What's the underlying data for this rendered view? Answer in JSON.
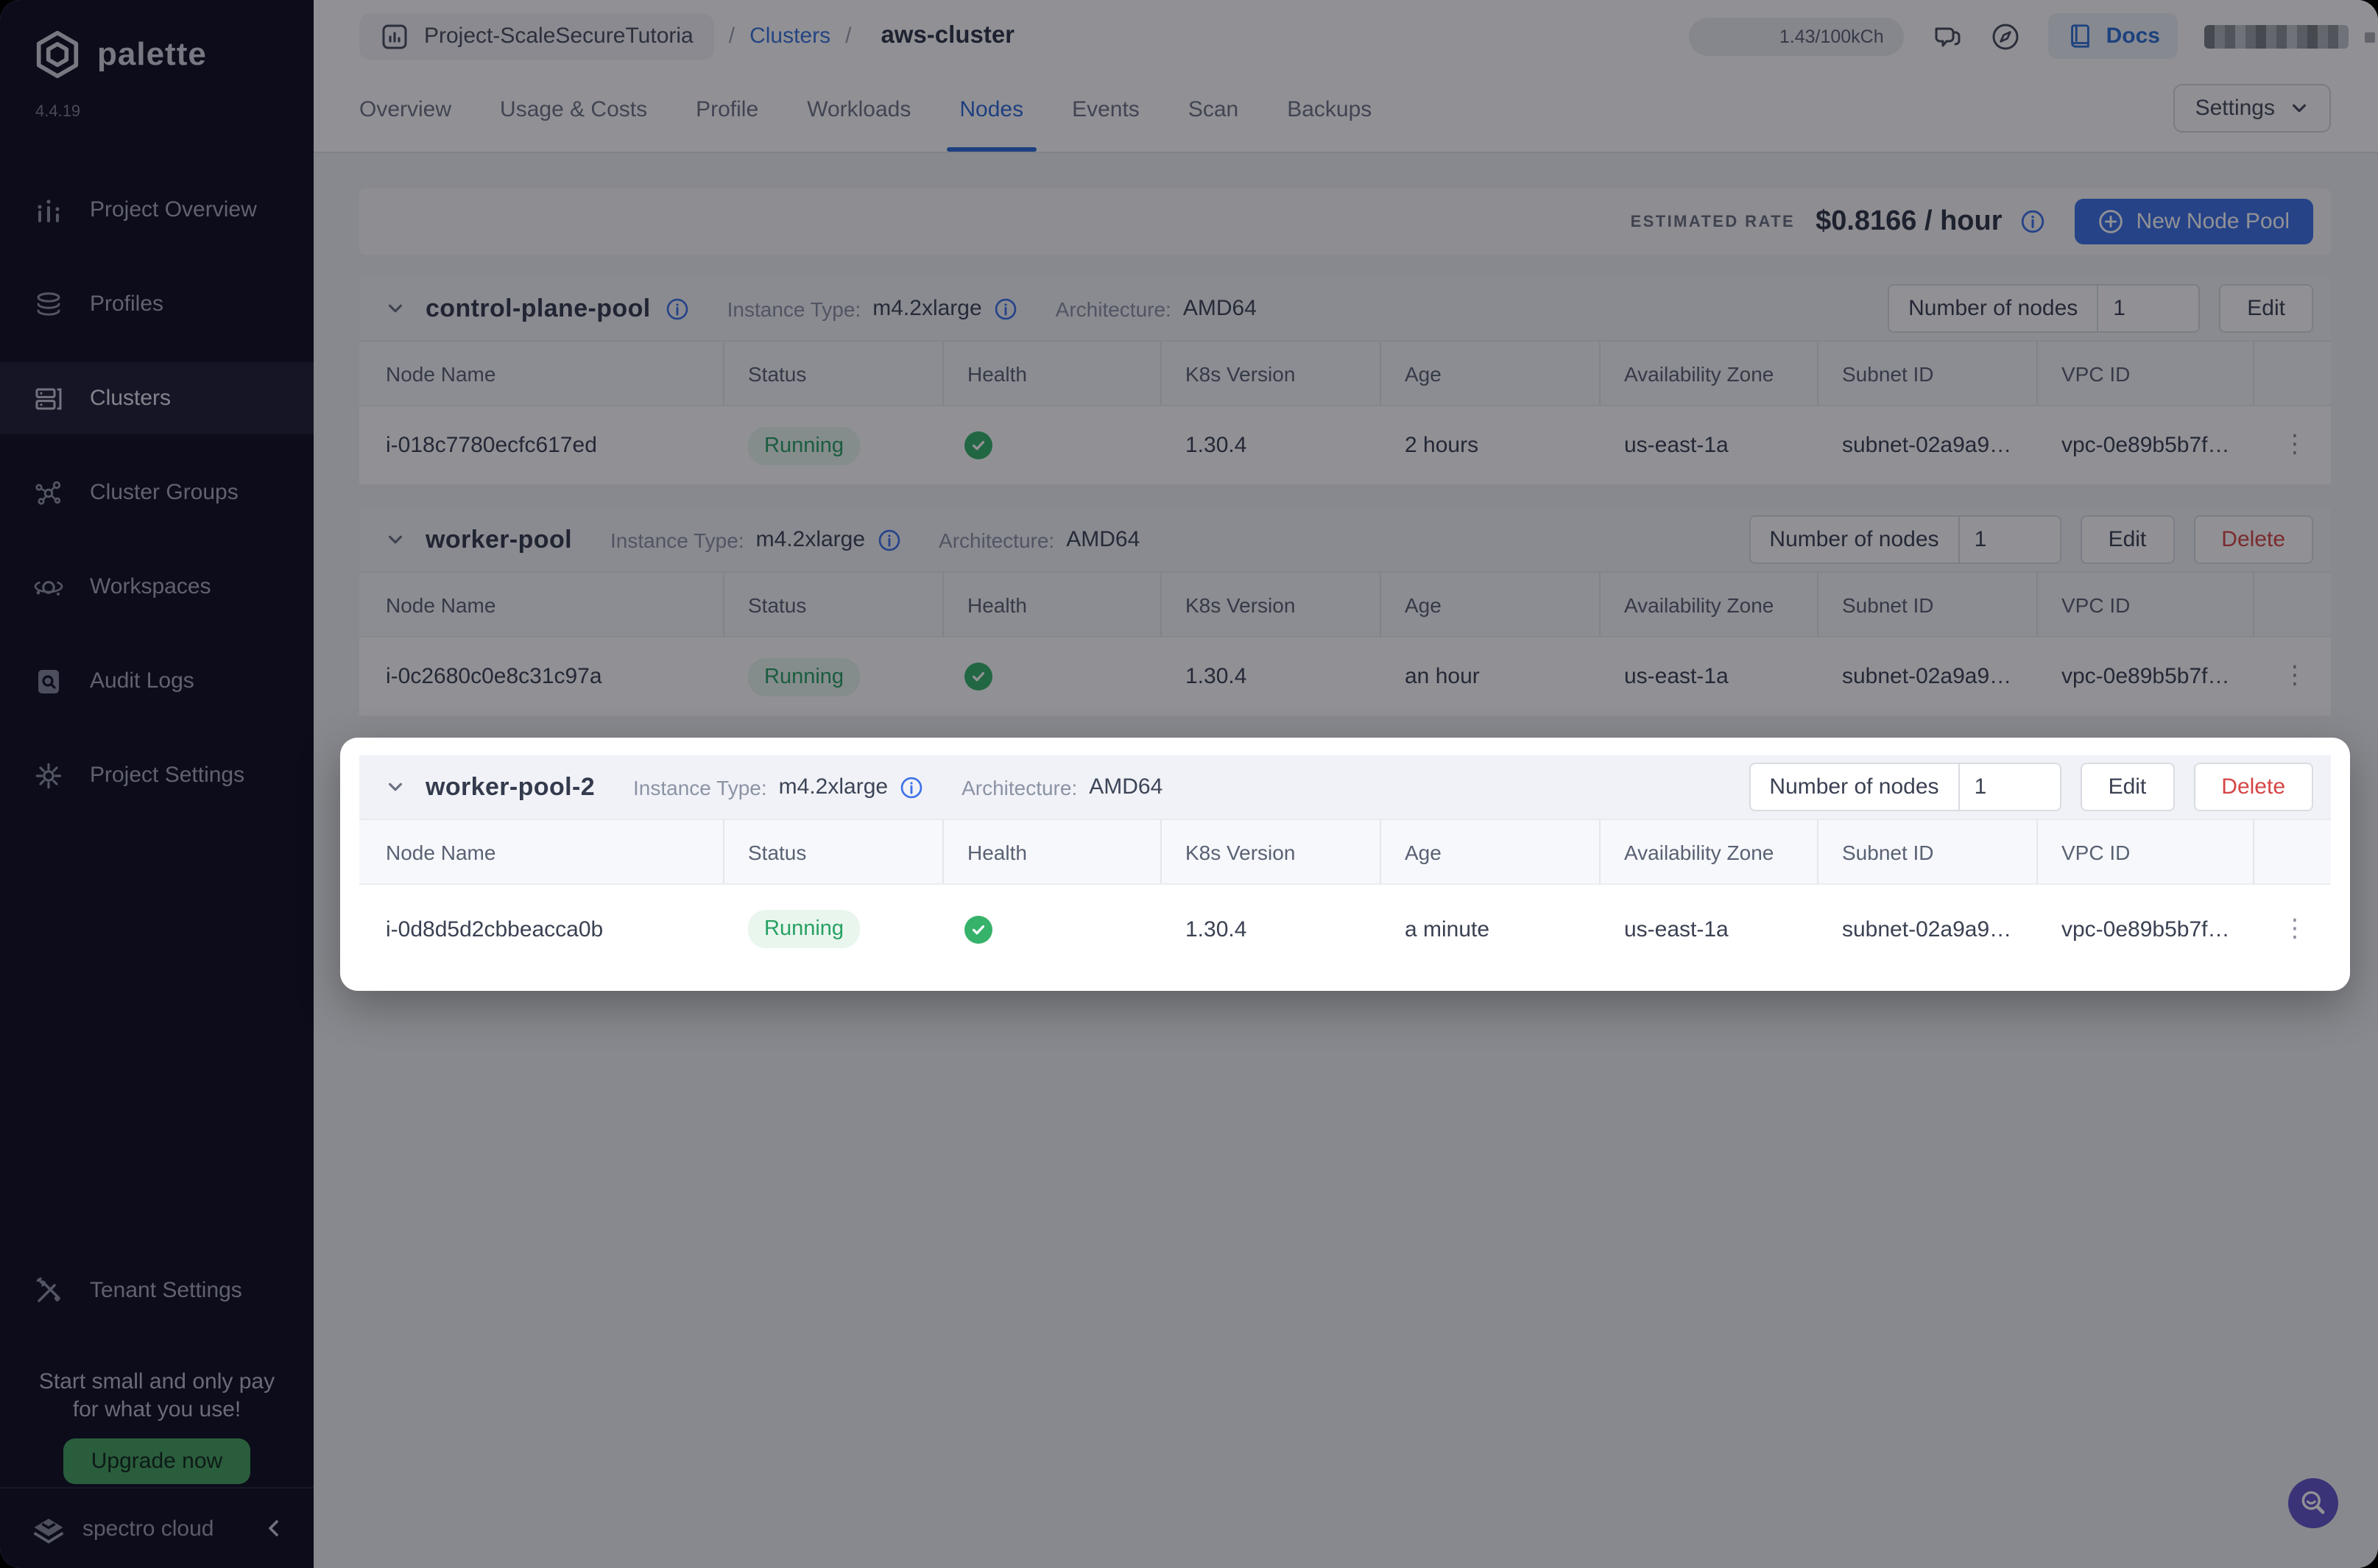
{
  "brand": {
    "name": "palette",
    "version": "4.4.19",
    "footer": "spectro cloud"
  },
  "colors": {
    "accent_blue": "#3d72e8",
    "link_blue": "#3b74dd",
    "active_tab_blue": "#2f6bd9",
    "success_green": "#36b26a",
    "badge_green_bg": "#e9f6ee",
    "badge_green_text": "#27a163",
    "danger_red": "#d64545",
    "sidebar_bg": "#0e0d1f",
    "fab_purple": "#6155c8",
    "upgrade_green": "#44a15e"
  },
  "sidebar": {
    "items": [
      {
        "label": "Project Overview",
        "icon": "bar-chart-icon",
        "active": false
      },
      {
        "label": "Profiles",
        "icon": "layers-icon",
        "active": false
      },
      {
        "label": "Clusters",
        "icon": "server-icon",
        "active": true
      },
      {
        "label": "Cluster Groups",
        "icon": "network-icon",
        "active": false
      },
      {
        "label": "Workspaces",
        "icon": "orbit-icon",
        "active": false
      },
      {
        "label": "Audit Logs",
        "icon": "audit-log-icon",
        "active": false
      },
      {
        "label": "Project Settings",
        "icon": "gear-icon",
        "active": false
      }
    ],
    "tenant_settings": "Tenant Settings",
    "promo": {
      "line1": "Start small and only pay",
      "line2": "for what you use!",
      "button": "Upgrade now"
    }
  },
  "topbar": {
    "project": "Project-ScaleSecureTutoria",
    "separator": "/",
    "clusters_link": "Clusters",
    "cluster_name": "aws-cluster",
    "usage": "1.43/100kCh",
    "docs": "Docs"
  },
  "tabs": {
    "items": [
      "Overview",
      "Usage & Costs",
      "Profile",
      "Workloads",
      "Nodes",
      "Events",
      "Scan",
      "Backups"
    ],
    "active": "Nodes",
    "settings": "Settings"
  },
  "ratebar": {
    "label": "ESTIMATED RATE",
    "value": "$0.8166 / hour",
    "new_pool": "New Node Pool"
  },
  "labels": {
    "instance_type": "Instance Type:",
    "architecture": "Architecture:",
    "number_of_nodes": "Number of nodes",
    "edit": "Edit",
    "delete": "Delete"
  },
  "table": {
    "headers": [
      "Node Name",
      "Status",
      "Health",
      "K8s Version",
      "Age",
      "Availability Zone",
      "Subnet ID",
      "VPC ID"
    ]
  },
  "pools": [
    {
      "name": "control-plane-pool",
      "instance_type": "m4.2xlarge",
      "architecture": "AMD64",
      "nodes_count": "1",
      "row": {
        "node": "i-018c7780ecfc617ed",
        "status": "Running",
        "k8s": "1.30.4",
        "age": "2 hours",
        "az": "us-east-1a",
        "subnet": "subnet-02a9a9…",
        "vpc": "vpc-0e89b5b7f…"
      }
    },
    {
      "name": "worker-pool",
      "instance_type": "m4.2xlarge",
      "architecture": "AMD64",
      "nodes_count": "1",
      "row": {
        "node": "i-0c2680c0e8c31c97a",
        "status": "Running",
        "k8s": "1.30.4",
        "age": "an hour",
        "az": "us-east-1a",
        "subnet": "subnet-02a9a9…",
        "vpc": "vpc-0e89b5b7f…"
      }
    },
    {
      "name": "worker-pool-2",
      "instance_type": "m4.2xlarge",
      "architecture": "AMD64",
      "nodes_count": "1",
      "row": {
        "node": "i-0d8d5d2cbbeacca0b",
        "status": "Running",
        "k8s": "1.30.4",
        "age": "a minute",
        "az": "us-east-1a",
        "subnet": "subnet-02a9a9…",
        "vpc": "vpc-0e89b5b7f…"
      }
    }
  ]
}
